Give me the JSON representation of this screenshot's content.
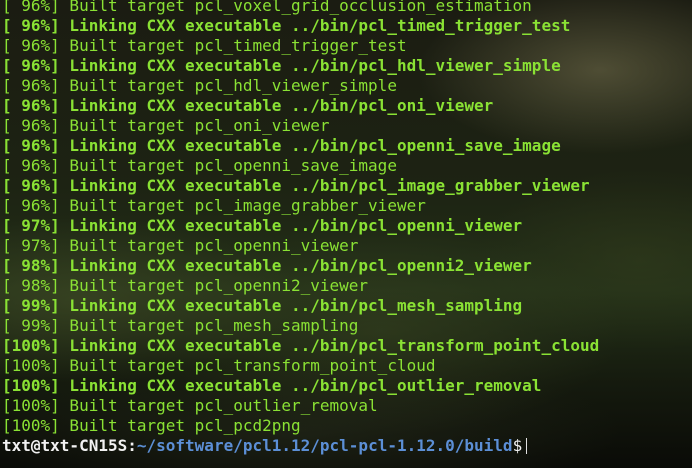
{
  "terminal": {
    "lines": [
      {
        "text": "[ 96%] Built target pcl_voxel_grid_occlusion_estimation",
        "bold": false
      },
      {
        "text": "[ 96%] Linking CXX executable ../bin/pcl_timed_trigger_test",
        "bold": true
      },
      {
        "text": "[ 96%] Built target pcl_timed_trigger_test",
        "bold": false
      },
      {
        "text": "[ 96%] Linking CXX executable ../bin/pcl_hdl_viewer_simple",
        "bold": true
      },
      {
        "text": "[ 96%] Built target pcl_hdl_viewer_simple",
        "bold": false
      },
      {
        "text": "[ 96%] Linking CXX executable ../bin/pcl_oni_viewer",
        "bold": true
      },
      {
        "text": "[ 96%] Built target pcl_oni_viewer",
        "bold": false
      },
      {
        "text": "[ 96%] Linking CXX executable ../bin/pcl_openni_save_image",
        "bold": true
      },
      {
        "text": "[ 96%] Built target pcl_openni_save_image",
        "bold": false
      },
      {
        "text": "[ 96%] Linking CXX executable ../bin/pcl_image_grabber_viewer",
        "bold": true
      },
      {
        "text": "[ 96%] Built target pcl_image_grabber_viewer",
        "bold": false
      },
      {
        "text": "[ 97%] Linking CXX executable ../bin/pcl_openni_viewer",
        "bold": true
      },
      {
        "text": "[ 97%] Built target pcl_openni_viewer",
        "bold": false
      },
      {
        "text": "[ 98%] Linking CXX executable ../bin/pcl_openni2_viewer",
        "bold": true
      },
      {
        "text": "[ 98%] Built target pcl_openni2_viewer",
        "bold": false
      },
      {
        "text": "[ 99%] Linking CXX executable ../bin/pcl_mesh_sampling",
        "bold": true
      },
      {
        "text": "[ 99%] Built target pcl_mesh_sampling",
        "bold": false
      },
      {
        "text": "[100%] Linking CXX executable ../bin/pcl_transform_point_cloud",
        "bold": true
      },
      {
        "text": "[100%] Built target pcl_transform_point_cloud",
        "bold": false
      },
      {
        "text": "[100%] Linking CXX executable ../bin/pcl_outlier_removal",
        "bold": true
      },
      {
        "text": "[100%] Built target pcl_outlier_removal",
        "bold": false
      },
      {
        "text": "[100%] Built target pcl_pcd2png",
        "bold": false
      }
    ],
    "prompt": {
      "user_host": "txt@txt-CN15S",
      "separator": ":",
      "path": "~/software/pcl1.12/pcl-pcl-1.12.0/build",
      "symbol": "$"
    },
    "colors": {
      "output_text": "#8ae234",
      "prompt_user": "#f2f2f2",
      "prompt_path": "#5c8fd6"
    }
  }
}
